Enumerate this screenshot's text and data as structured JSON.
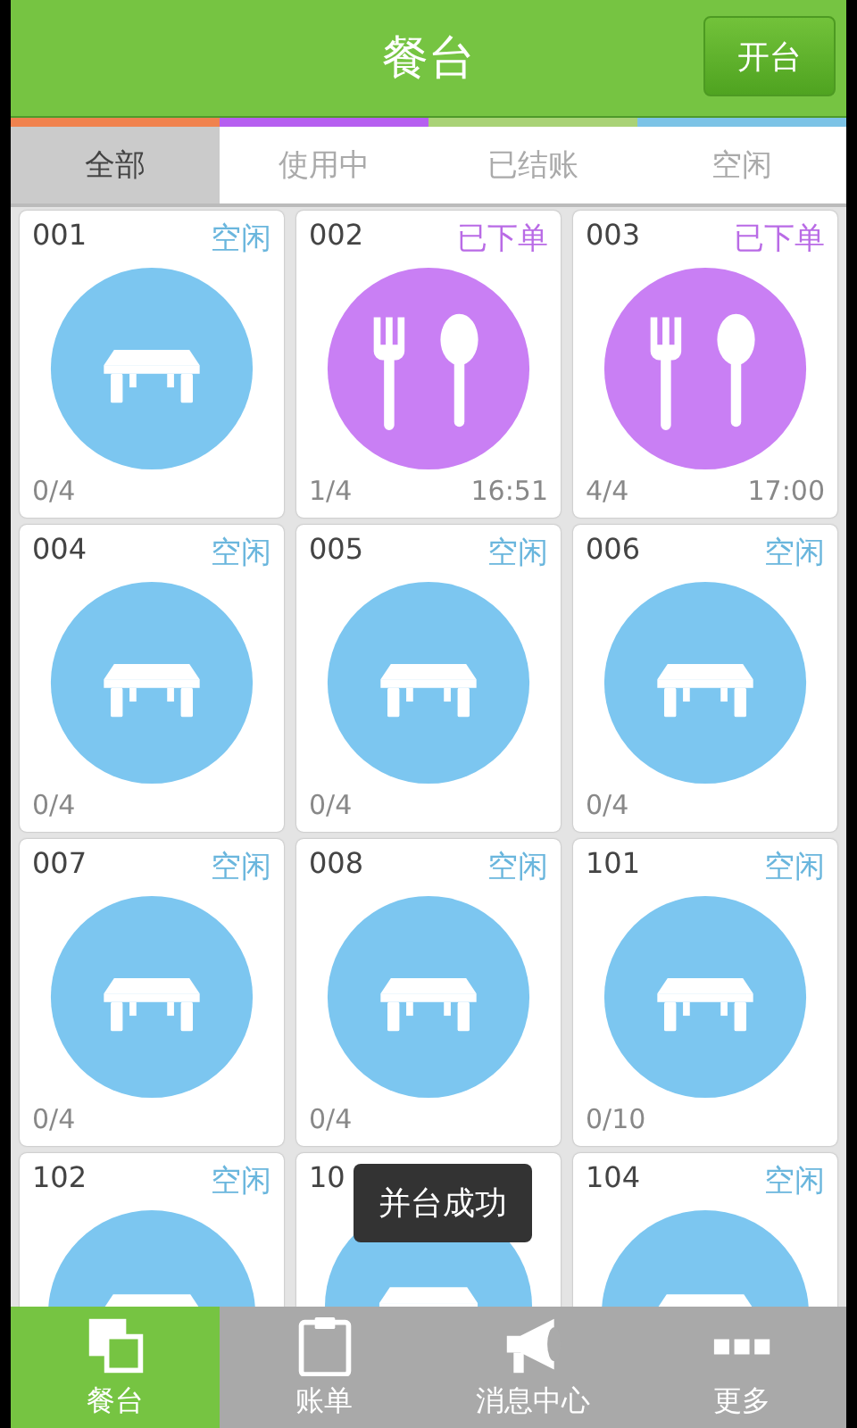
{
  "header": {
    "title": "餐台",
    "action": "开台"
  },
  "tabs": [
    {
      "label": "全部",
      "selected": true,
      "color": "#f0824e"
    },
    {
      "label": "使用中",
      "selected": false,
      "color": "#b65ff0"
    },
    {
      "label": "已结账",
      "selected": false,
      "color": "#a9d276"
    },
    {
      "label": "空闲",
      "selected": false,
      "color": "#7cc3e6"
    }
  ],
  "tables": [
    {
      "number": "001",
      "kind": "idle",
      "status": "空闲",
      "guests": "0/4"
    },
    {
      "number": "002",
      "kind": "ordered",
      "status": "已下单",
      "guests": "1/4",
      "time": "16:51"
    },
    {
      "number": "003",
      "kind": "ordered",
      "status": "已下单",
      "guests": "4/4",
      "time": "17:00"
    },
    {
      "number": "004",
      "kind": "idle",
      "status": "空闲",
      "guests": "0/4"
    },
    {
      "number": "005",
      "kind": "idle",
      "status": "空闲",
      "guests": "0/4"
    },
    {
      "number": "006",
      "kind": "idle",
      "status": "空闲",
      "guests": "0/4"
    },
    {
      "number": "007",
      "kind": "idle",
      "status": "空闲",
      "guests": "0/4"
    },
    {
      "number": "008",
      "kind": "idle",
      "status": "空闲",
      "guests": "0/4"
    },
    {
      "number": "101",
      "kind": "idle",
      "status": "空闲",
      "guests": "0/10"
    },
    {
      "number": "102",
      "kind": "idle",
      "status": "空闲"
    },
    {
      "number": "10",
      "kind": "idle"
    },
    {
      "number": "104",
      "kind": "idle",
      "status": "空闲"
    }
  ],
  "toast": "并台成功",
  "bottom_nav": [
    {
      "label": "餐台",
      "kind": "tables",
      "selected": true
    },
    {
      "label": "账单",
      "kind": "bill",
      "selected": false
    },
    {
      "label": "消息中心",
      "kind": "messages",
      "selected": false
    },
    {
      "label": "更多",
      "kind": "more",
      "selected": false
    }
  ]
}
